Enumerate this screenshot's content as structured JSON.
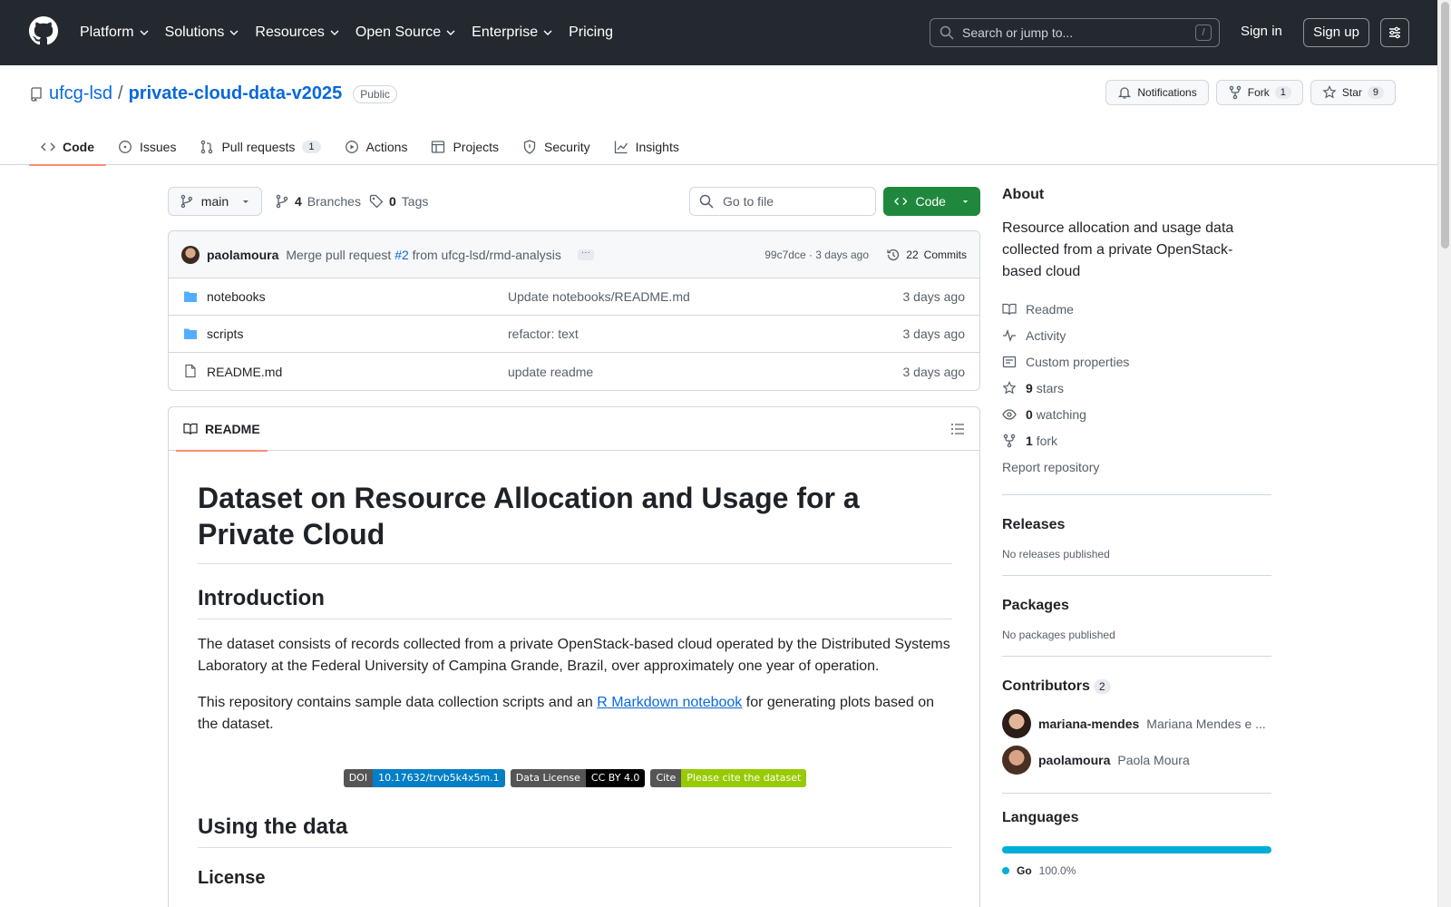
{
  "header": {
    "nav": [
      "Platform",
      "Solutions",
      "Resources",
      "Open Source",
      "Enterprise"
    ],
    "pricing": "Pricing",
    "search_placeholder": "Search or jump to...",
    "search_shortcut": "/",
    "signin": "Sign in",
    "signup": "Sign up"
  },
  "repo": {
    "owner": "ufcg-lsd",
    "separator": "/",
    "name": "private-cloud-data-v2025",
    "visibility": "Public",
    "notifications_label": "Notifications",
    "fork_label": "Fork",
    "fork_count": "1",
    "star_label": "Star",
    "star_count": "9"
  },
  "tabs": {
    "code": "Code",
    "issues": "Issues",
    "pulls": "Pull requests",
    "pulls_count": "1",
    "actions": "Actions",
    "projects": "Projects",
    "security": "Security",
    "insights": "Insights"
  },
  "branchbar": {
    "branch": "main",
    "branches_count": "4",
    "branches_label": "Branches",
    "tags_count": "0",
    "tags_label": "Tags",
    "goto_placeholder": "Go to file",
    "code_button": "Code"
  },
  "commit": {
    "author": "paolamoura",
    "msg_prefix": "Merge pull request",
    "pr": "#2",
    "msg_suffix": "from ufcg-lsd/rmd-analysis",
    "meta": "99c7dce · 3 days ago",
    "commits_count": "22",
    "commits_label": "Commits"
  },
  "files": [
    {
      "type": "folder",
      "name": "notebooks",
      "message": "Update notebooks/README.md",
      "date": "3 days ago"
    },
    {
      "type": "folder",
      "name": "scripts",
      "message": "refactor: text",
      "date": "3 days ago"
    },
    {
      "type": "file",
      "name": "README.md",
      "message": "update readme",
      "date": "3 days ago"
    }
  ],
  "readme": {
    "tab": "README",
    "h1": "Dataset on Resource Allocation and Usage for a Private Cloud",
    "intro_heading": "Introduction",
    "p1": "The dataset consists of records collected from a private OpenStack-based cloud operated by the Distributed Systems Laboratory at the Federal University of Campina Grande, Brazil, over approximately one year of operation.",
    "p2_before": "This repository contains sample data collection scripts and an ",
    "p2_link": "R Markdown notebook",
    "p2_after": " for generating plots based on the dataset.",
    "badges": [
      {
        "left": "DOI",
        "right": "10.17632/trvb5k4x5m.1",
        "color": "#007ec6"
      },
      {
        "left": "Data License",
        "right": "CC BY 4.0",
        "color": "#000000"
      },
      {
        "left": "Cite",
        "right": "Please cite the dataset",
        "color": "#97ca00"
      }
    ],
    "using_heading": "Using the data",
    "license_heading": "License"
  },
  "sidebar": {
    "about_title": "About",
    "about_desc": "Resource allocation and usage data collected from a private OpenStack-based cloud",
    "readme": "Readme",
    "activity": "Activity",
    "custom_properties": "Custom properties",
    "stars_count": "9",
    "stars_label": "stars",
    "watching_count": "0",
    "watching_label": "watching",
    "fork_count": "1",
    "fork_label": "fork",
    "report": "Report repository",
    "releases_title": "Releases",
    "releases_empty": "No releases published",
    "packages_title": "Packages",
    "packages_empty": "No packages published",
    "contributors_title": "Contributors",
    "contributors_count": "2",
    "contributors": [
      {
        "login": "mariana-mendes",
        "name": "Mariana Mendes e ..."
      },
      {
        "login": "paolamoura",
        "name": "Paola Moura"
      }
    ],
    "languages_title": "Languages",
    "languages": [
      {
        "name": "Go",
        "percent": "100.0%",
        "color": "#00add8"
      }
    ]
  }
}
